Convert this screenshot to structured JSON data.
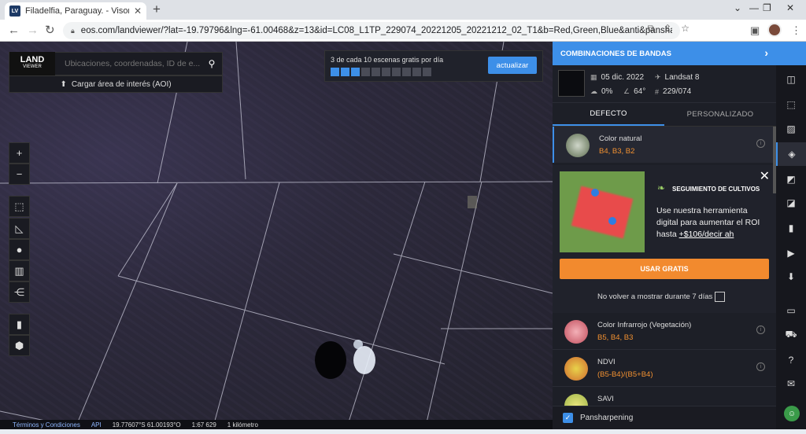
{
  "browser": {
    "tab_title": "Filadelfia, Paraguay. - Visor de te",
    "favicon": "LV",
    "url": "eos.com/landviewer/?lat=-19.79796&lng=-61.00468&z=13&id=LC08_L1TP_229074_20221205_20221212_02_T1&b=Red,Green,Blue&anti&pansharpening"
  },
  "map": {
    "logo_main": "LAND",
    "logo_sub": "VIEWER",
    "search_placeholder": "Ubicaciones, coordenadas, ID de e...",
    "aoi_label": "Cargar área de interés (AOI)",
    "scenes_text": "3 de cada 10 escenas gratis por día",
    "scenes_used": 3,
    "scenes_total": 10,
    "update_label": "actualizar",
    "tools": [
      "zoom-in-icon",
      "zoom-out-icon",
      "aoi-draw-icon",
      "measure-icon",
      "pin-icon",
      "book-icon",
      "share-icon",
      "chart-icon",
      "3d-icon"
    ]
  },
  "status": {
    "terms": "Términos y Condiciones",
    "api": "API",
    "coords": "19.77607°S 61.00193°O",
    "scale": "1:67 629",
    "distance": "1 kilómetro"
  },
  "panel": {
    "title": "COMBINACIONES DE BANDAS",
    "date": "05 dic. 2022",
    "satellite": "Landsat 8",
    "cloud": "0%",
    "angle": "64°",
    "path_row": "229/074",
    "tab_default": "DEFECTO",
    "tab_custom": "PERSONALIZADO",
    "bands": [
      {
        "name": "Color natural",
        "channels": "B4, B3, B2"
      },
      {
        "name": "Color Infrarrojo (Vegetación)",
        "channels": "B5, B4, B3"
      },
      {
        "name": "NDVI",
        "channels": "(B5-B4)/(B5+B4)"
      },
      {
        "name": "SAVI",
        "channels": ""
      }
    ],
    "promo": {
      "title": "SEGUIMIENTO DE CULTIVOS",
      "text_pre": "Use nuestra herramienta digital para aumentar el ROI hasta ",
      "text_link": "+$106/decir ah",
      "button": "USAR GRATIS",
      "dismiss": "No volver a mostrar durante 7 días"
    },
    "pansharpening": "Pansharpening"
  },
  "colors": {
    "accent": "#3d8fe8",
    "orange": "#f28a2e"
  }
}
